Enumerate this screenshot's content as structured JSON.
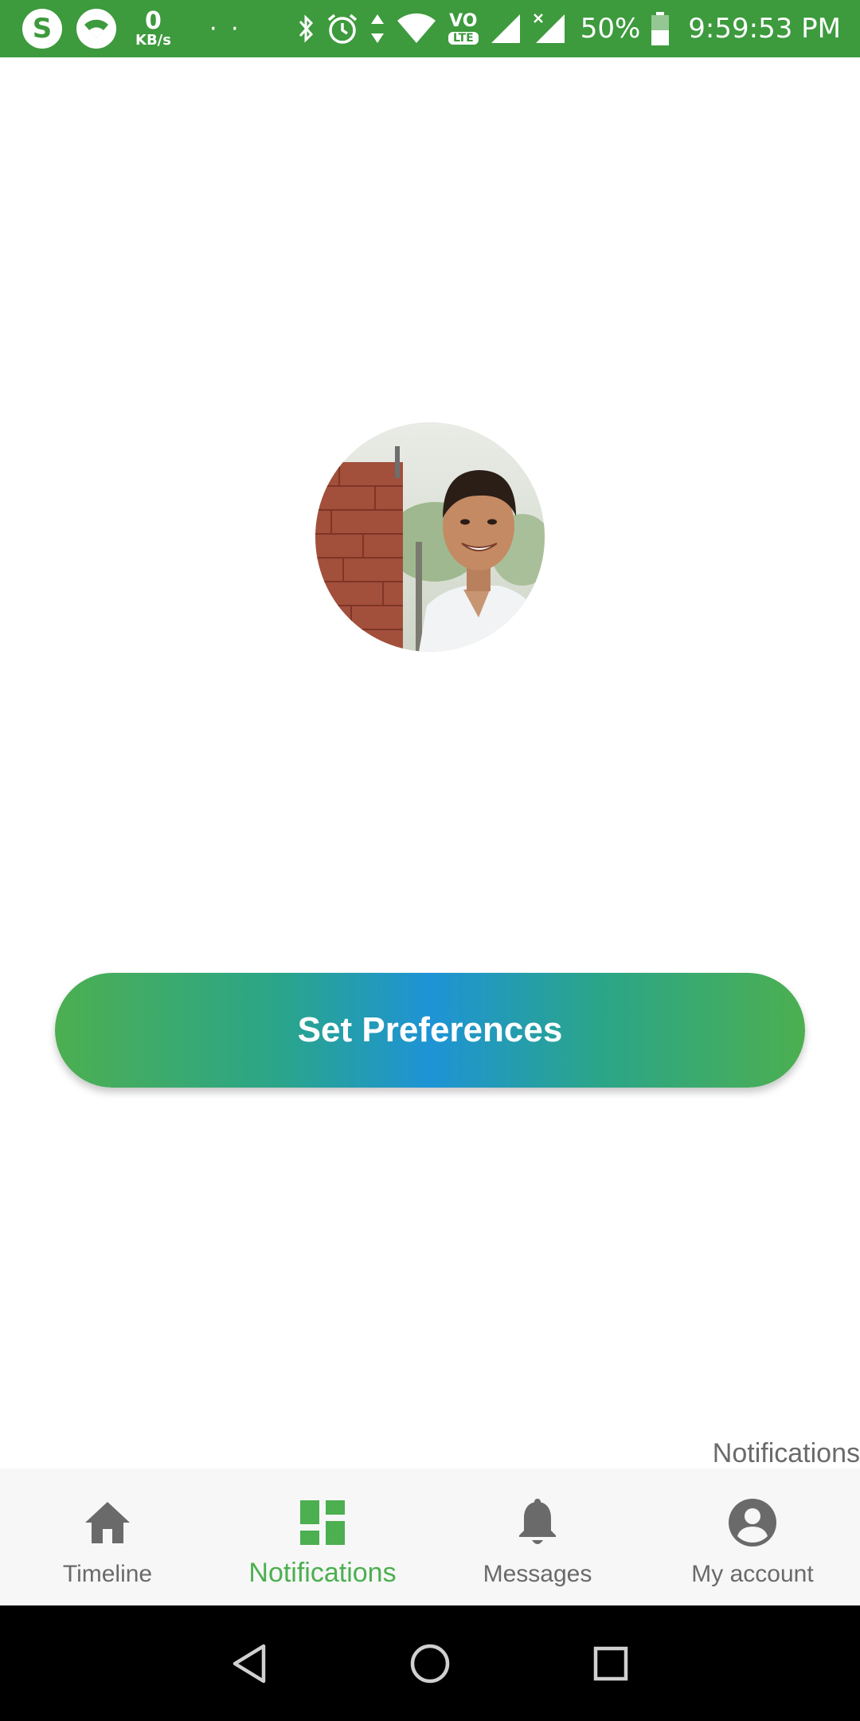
{
  "status_bar": {
    "background": "#3d9a3d",
    "icons": [
      "skype-icon",
      "wifi-icon",
      "bluetooth-icon",
      "alarm-icon",
      "data-arrows-icon",
      "wifi-signal-icon",
      "volte-icon",
      "cell-signal-icon",
      "cell-signal-no-data-icon",
      "battery-icon"
    ],
    "speed_value": "0",
    "speed_unit": "KB/s",
    "dots": "· ·",
    "volte_top": "VO",
    "volte_bottom": "LTE",
    "battery_percent": "50%",
    "battery_level": 0.5,
    "time": "9:59:53 PM"
  },
  "profile": {
    "avatar_icon": "profile-photo"
  },
  "main": {
    "button_label": "Set Preferences",
    "gradient_colors": [
      "#4caf50",
      "#1e93d6"
    ]
  },
  "floating_label": "Notifications",
  "bottom_nav": {
    "active_color": "#4caf50",
    "inactive_color": "#6a6a6a",
    "items": [
      {
        "label": "Timeline",
        "icon": "home-icon"
      },
      {
        "label": "Notifications",
        "icon": "dashboard-icon",
        "active": true
      },
      {
        "label": "Messages",
        "icon": "bell-icon"
      },
      {
        "label": "My account",
        "icon": "account-circle-icon"
      }
    ]
  },
  "system_nav": {
    "icons": [
      "back-icon",
      "home-circle-icon",
      "recents-icon"
    ]
  }
}
